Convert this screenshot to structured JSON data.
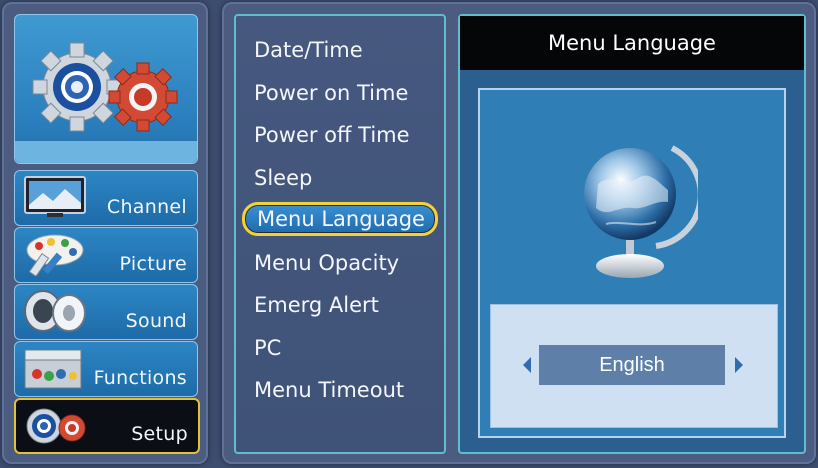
{
  "sidebar": {
    "items": [
      {
        "label": "Channel",
        "icon": "tv-icon"
      },
      {
        "label": "Picture",
        "icon": "palette-icon"
      },
      {
        "label": "Sound",
        "icon": "speaker-icon"
      },
      {
        "label": "Functions",
        "icon": "toolbox-icon"
      },
      {
        "label": "Setup",
        "icon": "gears-icon"
      }
    ],
    "active": "Setup"
  },
  "menu": {
    "items": [
      "Date/Time",
      "Power on Time",
      "Power off Time",
      "Sleep",
      "Menu Language",
      "Menu Opacity",
      "Emerg Alert",
      "PC",
      "Menu Timeout"
    ],
    "selected": "Menu Language"
  },
  "detail": {
    "title": "Menu Language",
    "value": "English",
    "icon": "globe-icon"
  },
  "colors": {
    "background": "#3d4d6f",
    "selection_border": "#f2d23a",
    "panel_border": "#5fbdd0",
    "title_bar": "#050607"
  }
}
